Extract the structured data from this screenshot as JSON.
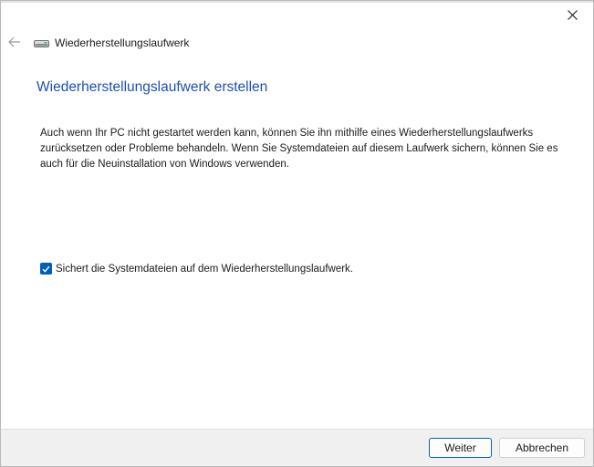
{
  "window": {
    "title": "Wiederherstellungslaufwerk",
    "title_icon": "drive-icon",
    "close_icon": "close-icon",
    "back_icon": "back-arrow-icon"
  },
  "main": {
    "heading": "Wiederherstellungslaufwerk erstellen",
    "description": "Auch wenn Ihr PC nicht gestartet werden kann, können Sie ihn mithilfe eines Wiederherstellungslaufwerks zurücksetzen oder Probleme behandeln. Wenn Sie Systemdateien auf diesem Laufwerk sichern, können Sie es auch für die Neuinstallation von Windows verwenden.",
    "backup_checkbox": {
      "label": "Sichert die Systemdateien auf dem Wiederherstellungslaufwerk.",
      "checked": true
    }
  },
  "footer": {
    "next_label": "Weiter",
    "cancel_label": "Abbrechen"
  },
  "colors": {
    "accent": "#005fb8",
    "heading": "#1f4fb0"
  }
}
